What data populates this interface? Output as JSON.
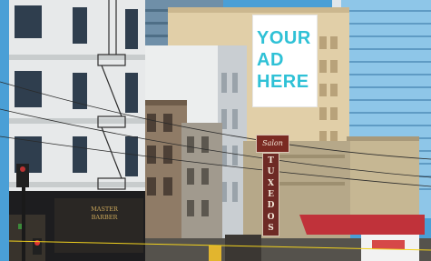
{
  "billboard": {
    "lines": [
      "YOUR",
      "AD",
      "HERE"
    ],
    "text_color": "#2fc1d6",
    "background": "#ffffff"
  },
  "signs": {
    "top_script": "Salon",
    "vertical_letters": [
      "T",
      "U",
      "X",
      "E",
      "D",
      "O",
      "S"
    ]
  },
  "storefront": {
    "lines": [
      "MASTER",
      "BARBER"
    ]
  },
  "colors": {
    "sky": "#4a9fd6",
    "glass_tower": "#8ec6e8",
    "sign_red": "#7a2a22",
    "awning_red": "#c0323a"
  }
}
